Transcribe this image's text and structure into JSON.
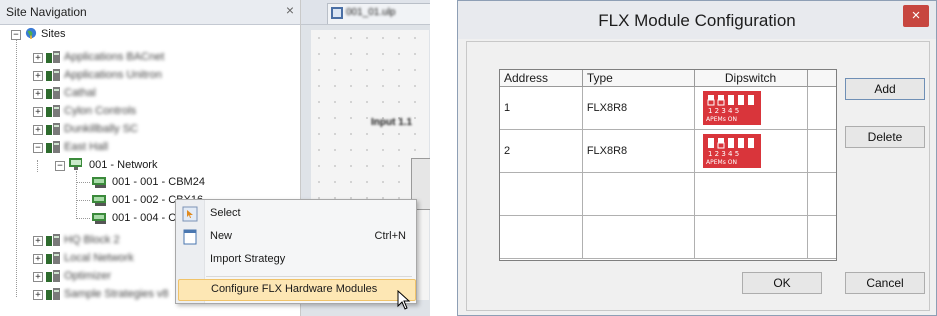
{
  "nav": {
    "title": "Site Navigation",
    "close_glyph": "×",
    "root": "Sites",
    "sites_before": [
      "Applications BACnet",
      "Applications Unitron",
      "Cathal",
      "Cylon Controls",
      "Dunkillbally SC"
    ],
    "expanded_site": "East Hall",
    "network": "001 - Network",
    "devices": [
      "001 - 001 - CBM24",
      "001 - 002 - CBX16",
      "001 - 004 - C"
    ],
    "sites_after": [
      "HQ Block 2",
      "Local Network",
      "Optimizer",
      "Sample Strategies v8"
    ]
  },
  "document": {
    "tab_label": "001_01.ulp",
    "node_label": "Input 1.1"
  },
  "context_menu": {
    "items": [
      {
        "label": "Select",
        "shortcut": ""
      },
      {
        "label": "New",
        "shortcut": "Ctrl+N"
      },
      {
        "label": "Import Strategy",
        "shortcut": ""
      },
      {
        "label": "Configure FLX Hardware Modules",
        "shortcut": ""
      }
    ]
  },
  "dialog": {
    "title": "FLX Module Configuration",
    "close_glyph": "×",
    "columns": [
      "Address",
      "Type",
      "Dipswitch"
    ],
    "rows": [
      {
        "address": "1",
        "type": "FLX8R8",
        "dip_positions": "1 2 3 4 5",
        "dip_caption": "APEMs ON"
      },
      {
        "address": "2",
        "type": "FLX8R8",
        "dip_positions": "1 2 3 4 5",
        "dip_caption": "APEMs ON"
      }
    ],
    "buttons": {
      "add": "Add",
      "delete": "Delete",
      "ok": "OK",
      "cancel": "Cancel"
    }
  },
  "colors": {
    "dip_red": "#d9353b",
    "menu_highlight": "#fde7b4",
    "close_red": "#c7463f"
  }
}
